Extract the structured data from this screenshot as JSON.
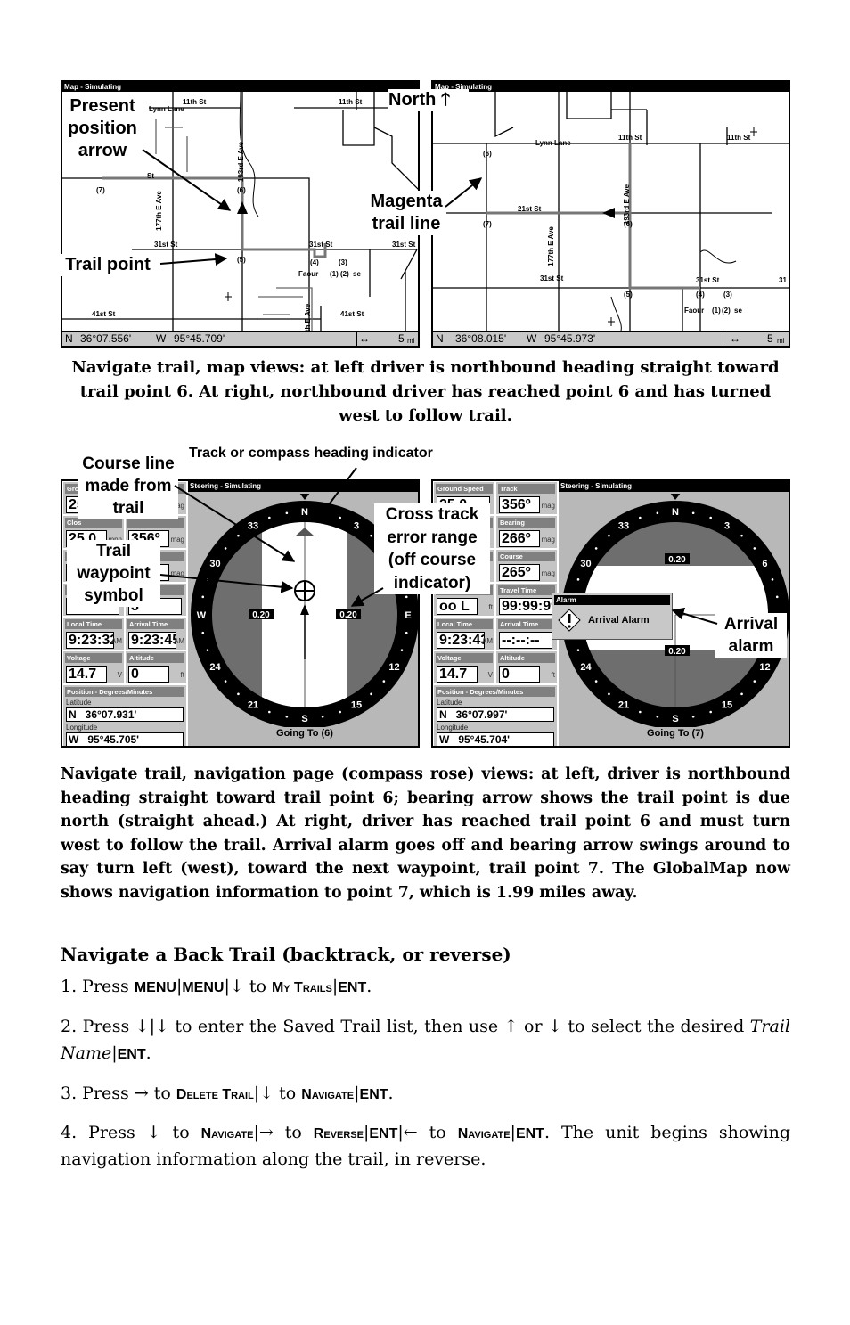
{
  "map_left": {
    "title": "Map - Simulating",
    "labels": {
      "lynn_lane": "Lynn Lane",
      "st11a": "11th St",
      "st11b": "11th St",
      "st_a": "St",
      "wp7": "(7)",
      "wp6": "(6)",
      "ave177": "177th E Ave",
      "ave193": "193rd E Ave",
      "st31a": "31st St",
      "st31b": "31st St",
      "st31c": "31st St",
      "wp5": "(5)",
      "wp4": "(4)",
      "wp3": "(3)",
      "faour": "Faour",
      "wp1": "(1)",
      "wp2": "(2)",
      "se": "se",
      "st41a": "41st St",
      "st41b": "41st St",
      "ave_th": "th E Ave"
    },
    "status": {
      "lat_hemi": "N",
      "lat": "36°07.556'",
      "lon_hemi": "W",
      "lon": "95°45.709'",
      "zoom_icon": "↔",
      "zoom": "5",
      "unit": "mi"
    }
  },
  "map_right": {
    "title": "Map - Simulating",
    "labels": {
      "lynn_lane": "Lynn Lane",
      "st11a": "11th St",
      "st11b": "11th St",
      "wp6a": "(6)",
      "wp7": "(7)",
      "st21": "21st St",
      "ave177": "177th E Ave",
      "ave193": "193rd E Ave",
      "wp6b": "(6)",
      "st31a": "31st St",
      "st31b": "31",
      "wp5": "(5)",
      "wp4": "(4)",
      "wp3": "(3)",
      "faour": "Faour",
      "wp1": "(1)",
      "wp2": "(2)",
      "se": "se"
    },
    "status": {
      "lat_hemi": "N",
      "lat": "36°08.015'",
      "lon_hemi": "W",
      "lon": "95°45.973'",
      "zoom_icon": "↔",
      "zoom": "5",
      "unit": "mi"
    }
  },
  "annotations_top": {
    "present_position": "Present position arrow",
    "north": "North",
    "north_icon": "arrow-up",
    "magenta": "Magenta trail line",
    "trail_point": "Trail point"
  },
  "caption_top": "Navigate trail, map views: at left driver is northbound heading straight toward trail point 6. At right, northbound driver has reached point 6 and has turned west to follow trail.",
  "nav_left": {
    "title": "Steering - Simulating",
    "fields": [
      {
        "label": "Grou",
        "value": "25",
        "unit": ""
      },
      {
        "label": "",
        "value": "",
        "unit": "mag"
      },
      {
        "label": "Clos",
        "value": "25.0",
        "unit": "mph"
      },
      {
        "label": "",
        "value": "356º",
        "unit": "mag"
      },
      {
        "label": "",
        "value": "",
        "unit": ""
      },
      {
        "label": "",
        "value": "",
        "unit": "mag"
      },
      {
        "label": "",
        "value": "",
        "unit": ""
      },
      {
        "label": "",
        "value": "3",
        "unit": ""
      },
      {
        "label": "Local Time",
        "value": "9:23:32",
        "unit": "AM"
      },
      {
        "label": "Arrival Time",
        "value": "9:23:45",
        "unit": "AM"
      },
      {
        "label": "Voltage",
        "value": "14.7",
        "unit": "V"
      },
      {
        "label": "Altitude",
        "value": "0",
        "unit": "ft"
      }
    ],
    "position": {
      "title": "Position - Degrees/Minutes",
      "lat_label": "Latitude",
      "lat": "N   36°07.931'",
      "lon_label": "Longitude",
      "lon": "W   95°45.705'"
    },
    "compass_labels": [
      "N",
      "3",
      "",
      "E",
      "12",
      "15",
      "S",
      "21",
      "24",
      "W",
      "30",
      "33"
    ],
    "xte_left": "0.20",
    "xte_right": "0.20",
    "going_to": "Going To (6)"
  },
  "nav_right": {
    "title": "Steering - Simulating",
    "fields": [
      {
        "label": "Ground Speed",
        "value": "25.0",
        "unit": ""
      },
      {
        "label": "Track",
        "value": "356º",
        "unit": "mag"
      },
      {
        "label": "",
        "value": "",
        "unit": ""
      },
      {
        "label": "Bearing",
        "value": "266º",
        "unit": "mag"
      },
      {
        "label": "",
        "value": "",
        "unit": ""
      },
      {
        "label": "Course",
        "value": "265º",
        "unit": "mag"
      },
      {
        "label": "",
        "value": "oo  L",
        "unit": "ft"
      },
      {
        "label": "Travel Time",
        "value": "99:99:99",
        "unit": ""
      },
      {
        "label": "Local Time",
        "value": "9:23:43",
        "unit": "AM"
      },
      {
        "label": "Arrival Time",
        "value": "--:--:--",
        "unit": ""
      },
      {
        "label": "Voltage",
        "value": "14.7",
        "unit": "V"
      },
      {
        "label": "Altitude",
        "value": "0",
        "unit": "ft"
      }
    ],
    "position": {
      "title": "Position - Degrees/Minutes",
      "lat_label": "Latitude",
      "lat": "N   36°07.997'",
      "lon_label": "Longitude",
      "lon": "W   95°45.704'"
    },
    "compass_labels": [
      "N",
      "3",
      "6",
      "",
      "12",
      "15",
      "S",
      "21",
      "24",
      "",
      "30",
      "33"
    ],
    "xte_top": "0.20",
    "xte_bottom": "0.20",
    "alarm": {
      "title": "Alarm",
      "text": "Arrival Alarm",
      "icon": "warning-diamond"
    },
    "going_to": "Going To (7)"
  },
  "annotations_bottom": {
    "course_line": "Course line made from trail",
    "heading": "Track or compass heading indicator",
    "waypoint": "Trail waypoint symbol",
    "xte": "Cross track error range (off course indicator)",
    "arrival": "Arrival alarm"
  },
  "caption_bottom": "Navigate trail, navigation page (compass rose) views: at left, driver is northbound heading straight toward trail point 6; bearing arrow shows the trail point is due north (straight ahead.)  At right, driver has reached trail point 6 and must turn west to follow the trail. Arrival alarm goes off and bearing arrow swings around to say turn left (west), toward the next waypoint, trail point 7. The GlobalMap now shows navigation information to point 7, which is 1.99 miles away.",
  "section_heading": "Navigate a Back Trail (backtrack, or reverse)",
  "steps": [
    [
      {
        "t": "1. Press "
      },
      {
        "t": "MENU",
        "s": "key"
      },
      {
        "t": "|"
      },
      {
        "t": "MENU",
        "s": "key"
      },
      {
        "t": "|↓ to "
      },
      {
        "t": "My Trails",
        "s": "sc"
      },
      {
        "t": "|"
      },
      {
        "t": "ENT",
        "s": "key"
      },
      {
        "t": "."
      }
    ],
    [
      {
        "t": "2. Press ↓|↓ to enter the Saved Trail list, then use ↑ or ↓ to select the desired "
      },
      {
        "t": "Trail Name",
        "s": "it"
      },
      {
        "t": "|"
      },
      {
        "t": "ENT",
        "s": "key"
      },
      {
        "t": "."
      }
    ],
    [
      {
        "t": "3. Press → to "
      },
      {
        "t": "Delete Trail",
        "s": "sc"
      },
      {
        "t": "|↓ to "
      },
      {
        "t": "Navigate",
        "s": "sc"
      },
      {
        "t": "|"
      },
      {
        "t": "ENT",
        "s": "key"
      },
      {
        "t": "."
      }
    ],
    [
      {
        "t": "4. Press ↓ to "
      },
      {
        "t": "Navigate",
        "s": "sc"
      },
      {
        "t": "|→ to "
      },
      {
        "t": "Reverse",
        "s": "sc"
      },
      {
        "t": "|"
      },
      {
        "t": "ENT",
        "s": "key"
      },
      {
        "t": "|← to "
      },
      {
        "t": "Navigate",
        "s": "sc"
      },
      {
        "t": "|"
      },
      {
        "t": "ENT",
        "s": "key"
      },
      {
        "t": ". The unit begins showing navigation information along the trail, in reverse."
      }
    ]
  ]
}
